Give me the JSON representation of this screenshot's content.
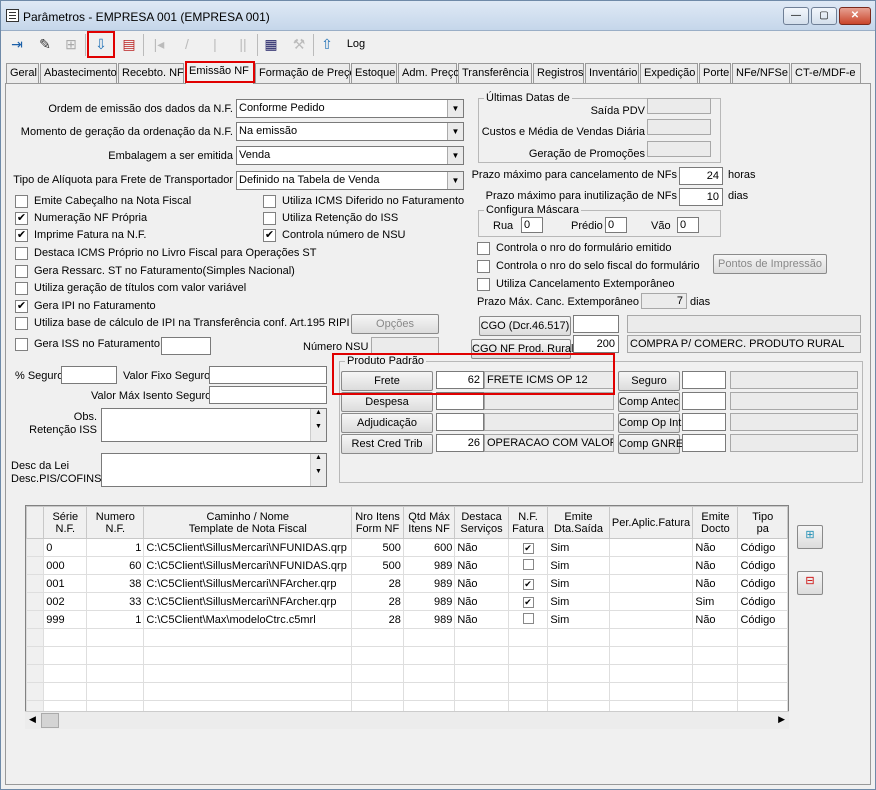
{
  "window": {
    "title": "Parâmetros - EMPRESA 001 (EMPRESA 001)"
  },
  "toolbar": {
    "log_label": "Log"
  },
  "tabs": [
    "Geral",
    "Abastecimento",
    "Recebto. NF",
    "Emissão NF",
    "Formação de Preço",
    "Estoque",
    "Adm. Preço",
    "Transferência",
    "Registros",
    "Inventário",
    "Expedição",
    "Porte",
    "NFe/NFSe",
    "CT-e/MDF-e"
  ],
  "form": {
    "ordem_label": "Ordem de emissão dos dados da N.F.",
    "ordem_value": "Conforme Pedido",
    "momento_label": "Momento de geração da ordenação da N.F.",
    "momento_value": "Na emissão",
    "embalagem_label": "Embalagem a ser emitida",
    "embalagem_value": "Venda",
    "aliquota_label": "Tipo de Alíquota para Frete de Transportador",
    "aliquota_value": "Definido na Tabela de Venda"
  },
  "ultimas": {
    "title": "Últimas Datas de",
    "saida_pdv": "Saída PDV",
    "custos": "Custos e Média de Vendas Diária",
    "promocoes": "Geração de Promoções"
  },
  "prazos": {
    "cancel_label": "Prazo máximo para cancelamento de NFs",
    "cancel_value": "24",
    "cancel_unit": "horas",
    "inut_label": "Prazo máximo para inutilização de NFs",
    "inut_value": "10",
    "inut_unit": "dias"
  },
  "mascara": {
    "title": "Configura Máscara",
    "rua_label": "Rua",
    "rua_value": "0",
    "predio_label": "Prédio",
    "predio_value": "0",
    "vao_label": "Vão",
    "vao_value": "0"
  },
  "checks_left": [
    {
      "label": "Emite Cabeçalho na Nota Fiscal",
      "checked": false
    },
    {
      "label": "Numeração NF Própria",
      "checked": true
    },
    {
      "label": "Imprime Fatura na N.F.",
      "checked": true
    },
    {
      "label": "Destaca ICMS Próprio no Livro Fiscal para Operações ST",
      "checked": false
    },
    {
      "label": "Gera Ressarc. ST no Faturamento(Simples Nacional)",
      "checked": false
    },
    {
      "label": "Utiliza geração de títulos com valor variável",
      "checked": false
    },
    {
      "label": "Gera IPI no Faturamento",
      "checked": true
    },
    {
      "label": "Utiliza base de cálculo de IPI na Transferência conf. Art.195 RIPI",
      "checked": false
    },
    {
      "label": "Gera ISS no Faturamento",
      "checked": false
    }
  ],
  "checks_mid": [
    {
      "label": "Utiliza ICMS Diferido no Faturamento",
      "checked": false
    },
    {
      "label": "Utiliza Retenção do ISS",
      "checked": false
    },
    {
      "label": "Controla número de NSU",
      "checked": true
    }
  ],
  "checks_right": [
    {
      "label": "Controla o nro do formulário emitido",
      "checked": false
    },
    {
      "label": "Controla o nro do selo fiscal do formulário",
      "checked": false
    },
    {
      "label": "Utiliza Cancelamento Extemporâneo",
      "checked": false
    }
  ],
  "pontos_btn": "Pontos de Impressão",
  "prazo_ext": {
    "label": "Prazo Máx. Canc. Extemporâneo",
    "value": "7",
    "unit": "dias"
  },
  "opcoes_btn": "Opções",
  "nsu_label": "Número NSU",
  "cgo": {
    "btn1": "CGO (Dcr.46.517)",
    "btn2": "CGO NF Prod. Rural",
    "code2": "200",
    "desc2": "COMPRA P/ COMERC. PRODUTO RURAL"
  },
  "seguro": {
    "pct_label": "% Seguro",
    "fixo_label": "Valor Fixo Seguro",
    "isento_label": "Valor Máx Isento Seguro"
  },
  "obs_label": "Obs.\nRetenção ISS",
  "desc_label": "Desc da Lei\nDesc.PIS/COFINS",
  "produto": {
    "title": "Produto Padrão",
    "rows": [
      {
        "btn": "Frete",
        "code": "62",
        "desc": "FRETE ICMS OP 12"
      },
      {
        "btn": "Despesa",
        "code": "",
        "desc": ""
      },
      {
        "btn": "Adjudicação",
        "code": "",
        "desc": ""
      },
      {
        "btn": "Rest Cred Trib",
        "code": "26",
        "desc": "OPERACAO COM VALOR"
      }
    ],
    "right": [
      "Seguro",
      "Comp Antec",
      "Comp Op Int",
      "Comp GNRE"
    ]
  },
  "grid": {
    "headers": [
      "Série\nN.F.",
      "Numero\nN.F.",
      "Caminho / Nome\nTemplate de Nota Fiscal",
      "Nro Itens\nForm NF",
      "Qtd Máx\nItens NF",
      "Destaca\nServiços",
      "N.F.\nFatura",
      "Emite\nDta.Saída",
      "Per.Aplic.Fatura",
      "Emite\nDocto",
      "Tipo\npa"
    ],
    "rows": [
      {
        "serie": "0",
        "numero": "1",
        "caminho": "C:\\C5Client\\SillusMercari\\NFUNIDAS.qrp",
        "nro": "500",
        "qtd": "600",
        "destaca": "Não",
        "fatura": true,
        "saida": "Sim",
        "per": "",
        "docto": "Não",
        "tipo": "Código"
      },
      {
        "serie": "000",
        "numero": "60",
        "caminho": "C:\\C5Client\\SillusMercari\\NFUNIDAS.qrp",
        "nro": "500",
        "qtd": "989",
        "destaca": "Não",
        "fatura": false,
        "saida": "Sim",
        "per": "",
        "docto": "Não",
        "tipo": "Código"
      },
      {
        "serie": "001",
        "numero": "38",
        "caminho": "C:\\C5Client\\SillusMercari\\NFArcher.qrp",
        "nro": "28",
        "qtd": "989",
        "destaca": "Não",
        "fatura": true,
        "saida": "Sim",
        "per": "",
        "docto": "Não",
        "tipo": "Código"
      },
      {
        "serie": "002",
        "numero": "33",
        "caminho": "C:\\C5Client\\SillusMercari\\NFArcher.qrp",
        "nro": "28",
        "qtd": "989",
        "destaca": "Não",
        "fatura": true,
        "saida": "Sim",
        "per": "",
        "docto": "Sim",
        "tipo": "Código"
      },
      {
        "serie": "999",
        "numero": "1",
        "caminho": "C:\\C5Client\\Max\\modeloCtrc.c5mrl",
        "nro": "28",
        "qtd": "989",
        "destaca": "Não",
        "fatura": false,
        "saida": "Sim",
        "per": "",
        "docto": "Não",
        "tipo": "Código"
      }
    ]
  }
}
